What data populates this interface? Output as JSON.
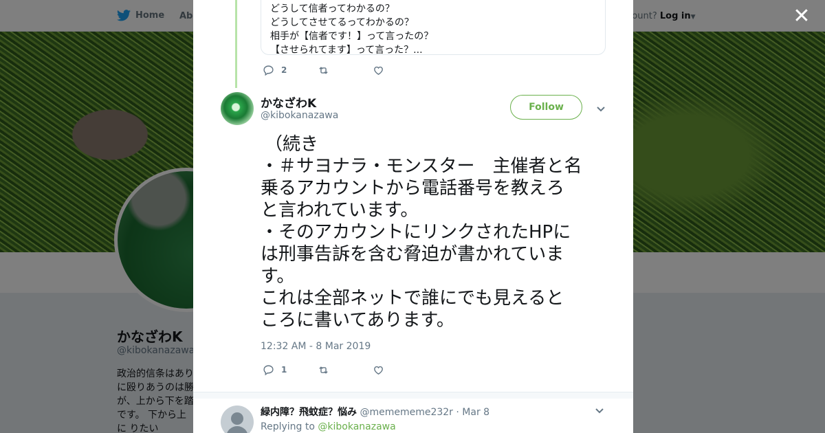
{
  "nav": {
    "home_label": "Home",
    "about_label": "Abo",
    "account_prompt": "ccount?",
    "login_label": "Log in"
  },
  "profile": {
    "name": "かなざわK",
    "handle": "@kibokanazawa",
    "bio": "政治的信条はあり に殴りあうのは勝 が、上から下を踏 です。 下から上に りたい"
  },
  "quote_card": {
    "lines": [
      "どうして信者ってわかるの？",
      "どうしてさせてるってわかるの？",
      "相手が【信者です！】って言ったの？",
      "【させられてます】って言った？..."
    ]
  },
  "quote_actions": {
    "reply_count": "2",
    "retweet_count": "",
    "like_count": ""
  },
  "tweet": {
    "author_name": "かなざわK",
    "author_handle": "@kibokanazawa",
    "follow_label": "Follow",
    "text_lines": [
      "（続き",
      "・＃サヨナラ・モンスター　主催者と名",
      "乗るアカウントから電話番号を教えろ",
      "と言われています。",
      "・そのアカウントにリンクされたHPに",
      "は刑事告訴を含む脅迫が書かれていま",
      "す。",
      "これは全部ネットで誰にでも見えると",
      "ころに書いてあります。"
    ],
    "timestamp": "12:32 AM - 8 Mar 2019",
    "reply_count": "1",
    "retweet_count": "",
    "like_count": ""
  },
  "reply": {
    "author_name": "緑内障？飛蚊症？悩み",
    "author_handle": "@memememe232r",
    "date": "· Mar 8",
    "replying_prefix": "Replying to",
    "replying_to": "@kibokanazawa"
  },
  "colors": {
    "accent": "#6ab04c",
    "thread_line": "#b7e3a8",
    "muted": "#657786",
    "text": "#14171a"
  },
  "icons": [
    "twitter-bird-icon",
    "close-icon",
    "reply-icon",
    "retweet-icon",
    "like-icon",
    "chevron-down-icon",
    "default-avatar-icon"
  ]
}
